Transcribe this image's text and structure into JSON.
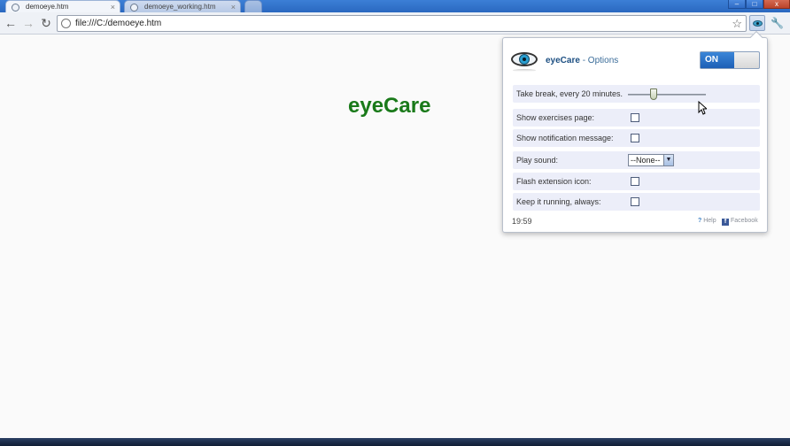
{
  "browser": {
    "tabs": [
      {
        "title": "demoeye.htm",
        "active": true
      },
      {
        "title": "demoeye_working.htm",
        "active": false
      }
    ],
    "url": "file:///C:/demoeye.htm",
    "window_buttons": {
      "minimize": "–",
      "maximize": "□",
      "close": "x"
    }
  },
  "page": {
    "title": "eyeCare",
    "title_color": "#1a7a1a"
  },
  "popup": {
    "app_name": "eyeCare",
    "subtitle": " - Options",
    "toggle_label": "ON",
    "toggle_state": true,
    "break_interval": {
      "label": "Take break, every 20 minutes.",
      "minutes": 20
    },
    "options": [
      {
        "label": "Show exercises page:",
        "checked": false
      },
      {
        "label": "Show notification message:",
        "checked": false
      }
    ],
    "sound": {
      "label": "Play sound:",
      "selected": "--None--"
    },
    "options2": [
      {
        "label": "Flash extension icon:",
        "checked": false
      },
      {
        "label": "Keep it running, always:",
        "checked": false
      }
    ],
    "timer": "19:59",
    "help_label": "Help",
    "facebook_label": "Facebook"
  }
}
